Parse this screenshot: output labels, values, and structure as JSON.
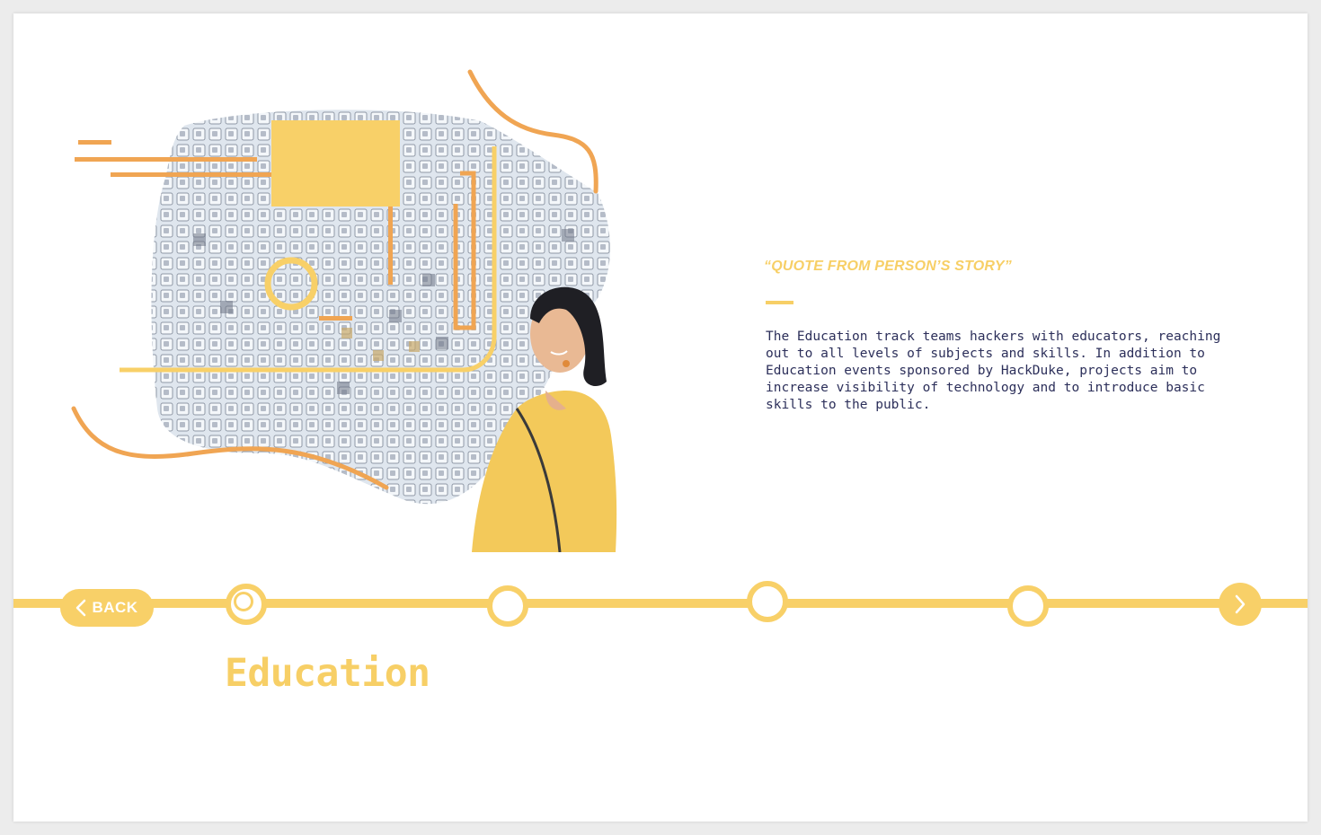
{
  "colors": {
    "accent_yellow": "#f8d068",
    "accent_orange": "#f0a553",
    "text_navy": "#2c2f5a",
    "background": "#ffffff"
  },
  "story": {
    "quote": "“QUOTE FROM PERSON’S STORY”",
    "description": "The Education track teams hackers with educators, reaching out to all levels of subjects and skills. In addition to Education events sponsored by HackDuke, projects aim to increase visibility of technology and to introduce basic skills to the public."
  },
  "navigation": {
    "back_label": "BACK",
    "back_icon": "chevron-left-icon",
    "next_icon": "chevron-right-icon",
    "active_index": 0,
    "node_count": 4
  },
  "section": {
    "title": "Education"
  }
}
